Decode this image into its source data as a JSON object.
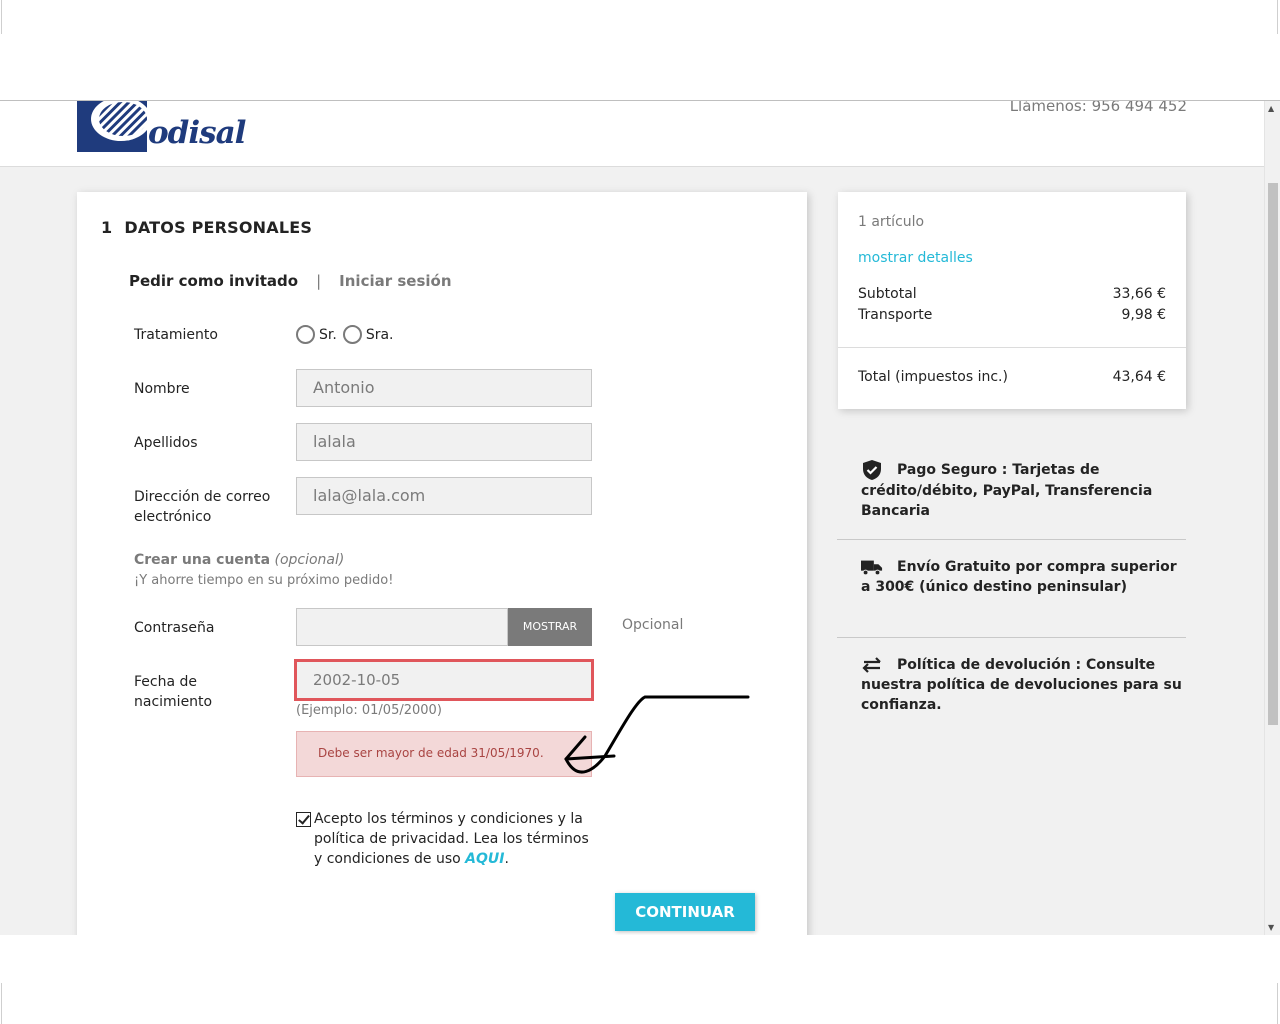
{
  "header": {
    "logo_text": "odisal",
    "phone": "Llámenos: 956 494 452"
  },
  "checkout": {
    "step_number": "1",
    "step_title": "DATOS PERSONALES",
    "tab_guest": "Pedir como invitado",
    "tab_sep": "|",
    "tab_login": "Iniciar sesión",
    "treatment_label": "Tratamiento",
    "treatment_options": [
      "Sr.",
      "Sra."
    ],
    "name_label": "Nombre",
    "name_value": "Antonio",
    "surname_label": "Apellidos",
    "surname_value": "lalala",
    "email_label": "Dirección de correo electrónico",
    "email_value": "lala@lala.com",
    "account_title": "Crear una cuenta",
    "account_optional": "(opcional)",
    "account_sub": "¡Y ahorre tiempo en su próximo pedido!",
    "password_label": "Contraseña",
    "show_button": "MOSTRAR",
    "password_hint": "Opcional",
    "birth_label": "Fecha de nacimiento",
    "birth_value": "2002-10-05",
    "birth_example": "(Ejemplo: 01/05/2000)",
    "error_message": "Debe ser mayor de edad 31/05/1970.",
    "terms_text": "Acepto los términos y condiciones y la política de privacidad. Lea los términos y condiciones de uso ",
    "terms_link": "AQUI",
    "terms_end": ".",
    "continue_button": "CONTINUAR"
  },
  "summary": {
    "count": "1 artículo",
    "details_link": "mostrar detalles",
    "subtotal_label": "Subtotal",
    "subtotal_value": "33,66 €",
    "shipping_label": "Transporte",
    "shipping_value": "9,98 €",
    "total_label": "Total (impuestos inc.)",
    "total_value": "43,64 €"
  },
  "reassurance": [
    {
      "icon": "shield-check-icon",
      "text": "Pago Seguro : Tarjetas de crédito/débito, PayPal, Transferencia Bancaria"
    },
    {
      "icon": "truck-icon",
      "text": "Envío Gratuito por compra superior a 300€ (único destino peninsular)"
    },
    {
      "icon": "arrows-exchange-icon",
      "text": "Política de devolución : Consulte nuestra política de devoluciones para su confianza."
    }
  ],
  "colors": {
    "accent": "#24b9d7",
    "error_border": "#e0565b",
    "error_bg": "#f3d8d8",
    "brand": "#1f3b7d"
  }
}
